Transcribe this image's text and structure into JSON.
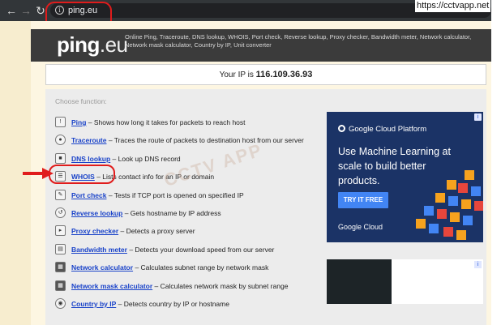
{
  "browser": {
    "url": "ping.eu",
    "watermark": "https://cctvapp.net"
  },
  "site": {
    "logo_main": "ping",
    "logo_tld": ".eu",
    "tagline": "Online Ping, Traceroute, DNS lookup, WHOIS, Port check, Reverse lookup, Proxy checker, Bandwidth meter, Network calculator, Network mask calculator, Country by IP, Unit converter"
  },
  "ip": {
    "label": "Your IP is",
    "value": "116.109.36.93"
  },
  "panel": {
    "choose_label": "Choose function:",
    "functions": [
      {
        "name": "Ping",
        "desc": "– Shows how long it takes for packets to reach host",
        "icon": "ping-icon"
      },
      {
        "name": "Traceroute",
        "desc": "– Traces the route of packets to destination host from our server",
        "icon": "traceroute-icon"
      },
      {
        "name": "DNS lookup",
        "desc": "– Look up DNS record",
        "icon": "dns-icon"
      },
      {
        "name": "WHOIS",
        "desc": "– Lists contact info for an IP or domain",
        "icon": "whois-icon"
      },
      {
        "name": "Port check",
        "desc": "– Tests if TCP port is opened on specified IP",
        "icon": "port-icon"
      },
      {
        "name": "Reverse lookup",
        "desc": "– Gets hostname by IP address",
        "icon": "reverse-icon"
      },
      {
        "name": "Proxy checker",
        "desc": "– Detects a proxy server",
        "icon": "proxy-icon"
      },
      {
        "name": "Bandwidth meter",
        "desc": "– Detects your download speed from our server",
        "icon": "bandwidth-icon"
      },
      {
        "name": "Network calculator",
        "desc": "– Calculates subnet range by network mask",
        "icon": "calculator-icon"
      },
      {
        "name": "Network mask calculator",
        "desc": "– Calculates network mask by subnet range",
        "icon": "mask-calculator-icon"
      },
      {
        "name": "Country by IP",
        "desc": "– Detects country by IP or hostname",
        "icon": "country-icon"
      }
    ]
  },
  "ad": {
    "brand": "Google Cloud Platform",
    "headline": "Use Machine Learning at scale to build better products.",
    "cta": "TRY IT FREE",
    "footer": "Google Cloud"
  },
  "colors": {
    "link": "#1a43c9",
    "highlight": "#e01c1c",
    "ad_bg": "#1b3366",
    "cta": "#4285f4"
  }
}
